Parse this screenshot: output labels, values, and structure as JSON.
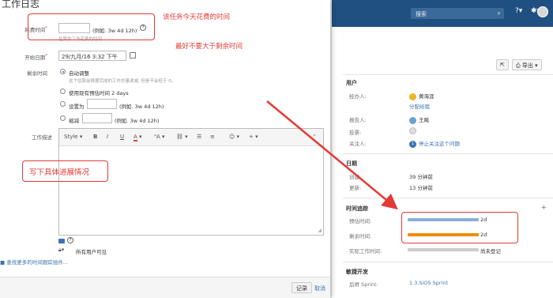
{
  "topbar": {
    "search_placeholder": "搜索",
    "icons": [
      "search-icon",
      "help-icon",
      "gear-icon"
    ]
  },
  "side": {
    "export_label": "导出",
    "people": {
      "title": "用户",
      "assignee_label": "经办人:",
      "assignee_name": "黄海涯",
      "assign_to_me": "分配给我",
      "reporter_label": "报告人:",
      "reporter_name": "王飚",
      "votes_label": "投票:",
      "watchers_label": "关注人:",
      "watchers_count": "1",
      "stop_watching": "停止关注这个问题"
    },
    "dates": {
      "title": "日期",
      "created_label": "创建:",
      "created_value": "39 分钟前",
      "updated_label": "更新:",
      "updated_value": "13 分钟前"
    },
    "time_tracking": {
      "title": "时间追踪",
      "estimated_label": "预估时间:",
      "estimated_value": "2d",
      "estimated_fraction": 1.0,
      "remaining_label": "剩余时间:",
      "remaining_value": "2d",
      "remaining_fraction": 1.0,
      "logged_label": "实际工作时间:",
      "logged_value": "尚未登记",
      "colors": {
        "estimated": "#89afd7",
        "remaining": "#ec8e00",
        "logged": "#cccccc"
      }
    },
    "agile": {
      "title": "敏捷开发",
      "sprint_label": "后继 Sprint:",
      "sprint_value": "1.3.SiOS Sprint"
    }
  },
  "dialog": {
    "title": "工作日志",
    "time_spent_label": "耗费时间",
    "time_spent_value": "",
    "time_spent_example": "(例如. 3w 4d 12h)",
    "time_spent_hint": "估算你工作花费的时间",
    "start_date_label": "开始日期",
    "start_date_value": "29/九月/16 3:32 下午",
    "remaining_label": "剩余时间",
    "options": [
      {
        "label": "自动调整",
        "selected": true,
        "hint": "这个估算会根据完成的工作总量递减, 但是不会低于 0。"
      },
      {
        "label": "使用现有预估时间 2 days",
        "selected": false
      },
      {
        "label": "设置为",
        "selected": false,
        "example": "(例如. 3w 4d 12h)"
      },
      {
        "label": "缩减",
        "selected": false,
        "example": "(例如. 3w 4d 12h)"
      }
    ],
    "description_label": "工作描述",
    "editor_style": "Style",
    "visibility": "所有用户可见",
    "more_link": "查找更多的时间跟踪插件...",
    "log_button": "记录",
    "cancel_button": "取消"
  },
  "annotations": {
    "a1": "该任务今天花费的时间",
    "a2": "最好不要大于剩余时间",
    "a3": "写下具体进展情况",
    "color": "#e53935"
  }
}
